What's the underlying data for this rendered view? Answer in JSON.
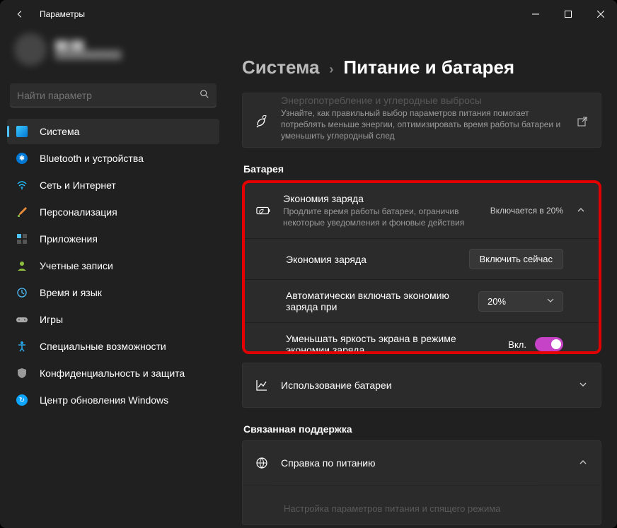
{
  "window": {
    "title": "Параметры"
  },
  "search": {
    "placeholder": "Найти параметр"
  },
  "nav": {
    "system": "Система",
    "bluetooth": "Bluetooth и устройства",
    "network": "Сеть и Интернет",
    "personalization": "Персонализация",
    "apps": "Приложения",
    "accounts": "Учетные записи",
    "time": "Время и язык",
    "gaming": "Игры",
    "accessibility": "Специальные возможности",
    "privacy": "Конфиденциальность и защита",
    "update": "Центр обновления Windows"
  },
  "breadcrumb": {
    "root": "Система",
    "current": "Питание и батарея"
  },
  "energy": {
    "title": "Энергопотребление и углеродные выбросы",
    "desc": "Узнайте, как правильный выбор параметров питания помогает потреблять меньше энергии, оптимизировать время работы батареи и уменьшить углеродный след"
  },
  "section_battery": "Батарея",
  "saver": {
    "title": "Экономия заряда",
    "desc": "Продлите время работы батареи, ограничив некоторые уведомления и фоновые действия",
    "status": "Включается в 20%",
    "row1_label": "Экономия заряда",
    "row1_btn": "Включить сейчас",
    "row2_label": "Автоматически включать экономию заряда при",
    "row2_value": "20%",
    "row3_label": "Уменьшать яркость экрана в режиме экономии заряда",
    "row3_toggle": "Вкл."
  },
  "usage": {
    "title": "Использование батареи"
  },
  "section_related": "Связанная поддержка",
  "help": {
    "title": "Справка по питанию"
  },
  "footer_hint": "Настройка параметров питания и спящего режима"
}
